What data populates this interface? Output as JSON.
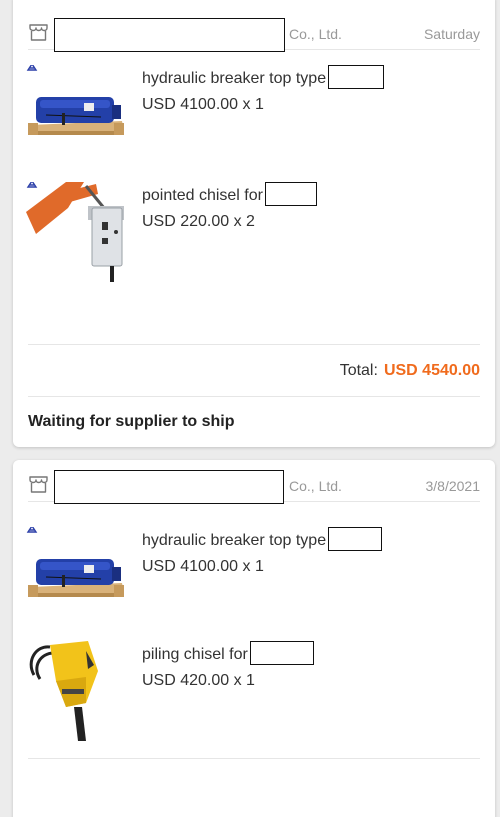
{
  "orders": [
    {
      "supplier_suffix": "Co., Ltd.",
      "date": "Saturday",
      "items": [
        {
          "name": "hydraulic breaker top type",
          "price": "USD 4100.00 x 1",
          "icon": "hydraulic-breaker-image"
        },
        {
          "name": "pointed chisel for",
          "price": "USD 220.00 x 2",
          "icon": "excavator-breaker-image"
        }
      ],
      "total_label": "Total:",
      "total_value": "USD 4540.00",
      "status": "Waiting for supplier to ship"
    },
    {
      "supplier_suffix": "Co., Ltd.",
      "date": "3/8/2021",
      "items": [
        {
          "name": "hydraulic breaker top type",
          "price": "USD 4100.00 x 1",
          "icon": "hydraulic-breaker-image"
        },
        {
          "name": "piling chisel for",
          "price": "USD 420.00 x 1",
          "icon": "yellow-breaker-image"
        }
      ]
    }
  ],
  "colors": {
    "accent": "#f06b1d",
    "muted": "#999999",
    "divider": "#e6e6e6"
  }
}
